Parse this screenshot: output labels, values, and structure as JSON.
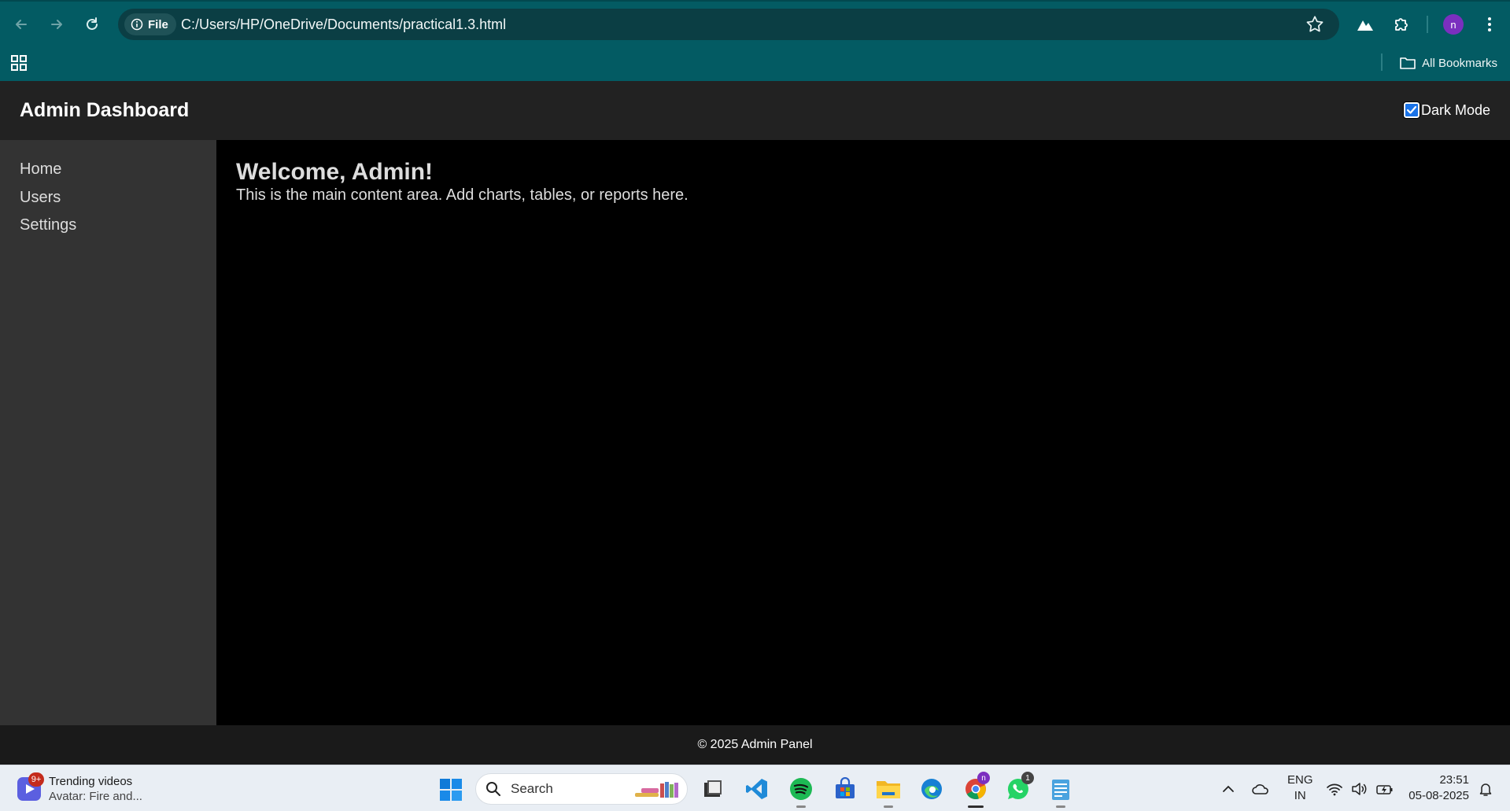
{
  "browser": {
    "site_chip_label": "File",
    "url": "C:/Users/HP/OneDrive/Documents/practical1.3.html",
    "profile_initial": "n",
    "bookmarks_label": "All Bookmarks"
  },
  "header": {
    "title": "Admin Dashboard",
    "dark_mode_label": "Dark Mode",
    "dark_mode_checked": true
  },
  "sidebar": {
    "items": [
      {
        "label": "Home"
      },
      {
        "label": "Users"
      },
      {
        "label": "Settings"
      }
    ]
  },
  "main": {
    "heading": "Welcome, Admin!",
    "text": "This is the main content area. Add charts, tables, or reports here."
  },
  "footer": {
    "text": "© 2025 Admin Panel"
  },
  "taskbar": {
    "widget_badge": "9+",
    "widget_title": "Trending videos",
    "widget_subtitle": "Avatar: Fire and...",
    "search_placeholder": "Search",
    "chrome_badge": "n",
    "whatsapp_badge": "1",
    "lang_line1": "ENG",
    "lang_line2": "IN",
    "time": "23:51",
    "date": "05-08-2025"
  },
  "colors": {
    "chrome_bg": "#035b63",
    "omnibox_bg": "#0b3e44",
    "header_bg": "#222222",
    "sidebar_bg": "#333333",
    "main_bg": "#000000",
    "footer_bg": "#1a1a1a",
    "checkbox_accent": "#1a73e8"
  }
}
